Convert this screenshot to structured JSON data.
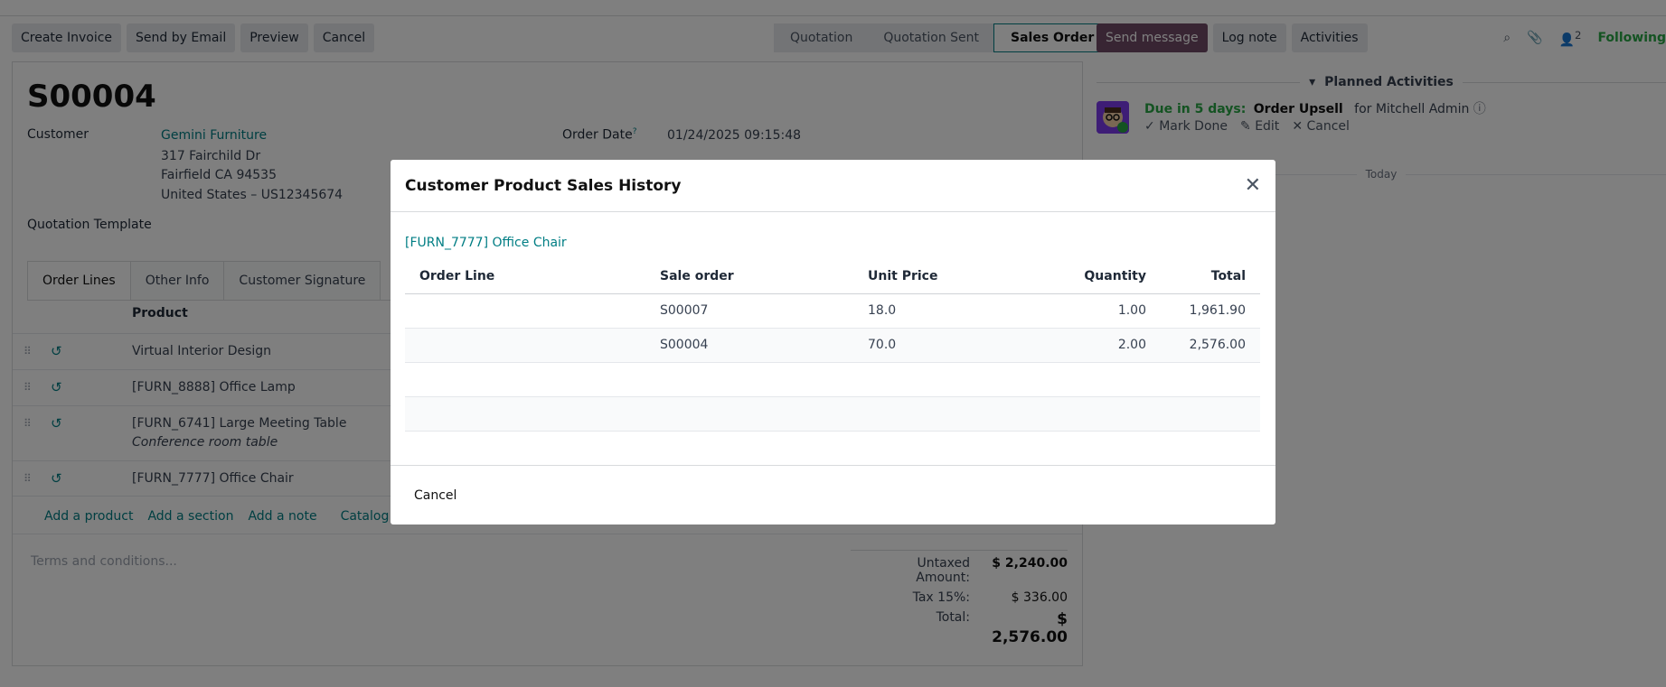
{
  "control": {
    "buttons": [
      "Create Invoice",
      "Send by Email",
      "Preview",
      "Cancel"
    ],
    "stages": [
      "Quotation",
      "Quotation Sent",
      "Sales Order"
    ]
  },
  "form": {
    "title": "S00004",
    "customer_label": "Customer",
    "customer_name": "Gemini Furniture",
    "address1": "317 Fairchild Dr",
    "address2": "Fairfield CA 94535",
    "address3": "United States – US12345674",
    "order_date_label": "Order Date",
    "order_date_help": "?",
    "order_date": "01/24/2025 09:15:48",
    "template_label": "Quotation Template",
    "tabs": [
      "Order Lines",
      "Other Info",
      "Customer Signature"
    ],
    "product_header": "Product",
    "lines": [
      {
        "name": "Virtual Interior Design",
        "note": ""
      },
      {
        "name": "[FURN_8888] Office Lamp",
        "note": ""
      },
      {
        "name": "[FURN_6741] Large Meeting Table",
        "note": "Conference room table"
      },
      {
        "name": "[FURN_7777] Office Chair",
        "note": ""
      }
    ],
    "add_links": [
      "Add a product",
      "Add a section",
      "Add a note",
      "Catalog"
    ],
    "terms_placeholder": "Terms and conditions...",
    "totals": {
      "untaxed_label": "Untaxed Amount:",
      "untaxed": "$ 2,240.00",
      "tax_label": "Tax 15%:",
      "tax": "$ 336.00",
      "total_label": "Total:",
      "total": "$ 2,576.00"
    }
  },
  "chatter": {
    "buttons": [
      "Send message",
      "Log note",
      "Activities"
    ],
    "followers_count": "2",
    "following": "Following",
    "planned": "Planned Activities",
    "due": "Due in 5 days:",
    "activity": "Order Upsell",
    "for_user": "for Mitchell Admin",
    "actions": [
      "Mark Done",
      "Edit",
      "Cancel"
    ],
    "today": "Today"
  },
  "modal": {
    "title": "Customer Product Sales History",
    "product_link": "[FURN_7777] Office Chair",
    "columns": [
      "Order Line",
      "Sale order",
      "Unit Price",
      "Quantity",
      "Total"
    ],
    "rows": [
      {
        "order_line": "",
        "sale_order": "S00007",
        "unit_price": "18.0",
        "quantity": "1.00",
        "total": "1,961.90"
      },
      {
        "order_line": "",
        "sale_order": "S00004",
        "unit_price": "70.0",
        "quantity": "2.00",
        "total": "2,576.00"
      }
    ],
    "cancel": "Cancel"
  },
  "colors": {
    "accent": "#017e84",
    "primary": "#714b67",
    "success": "#28a745"
  }
}
